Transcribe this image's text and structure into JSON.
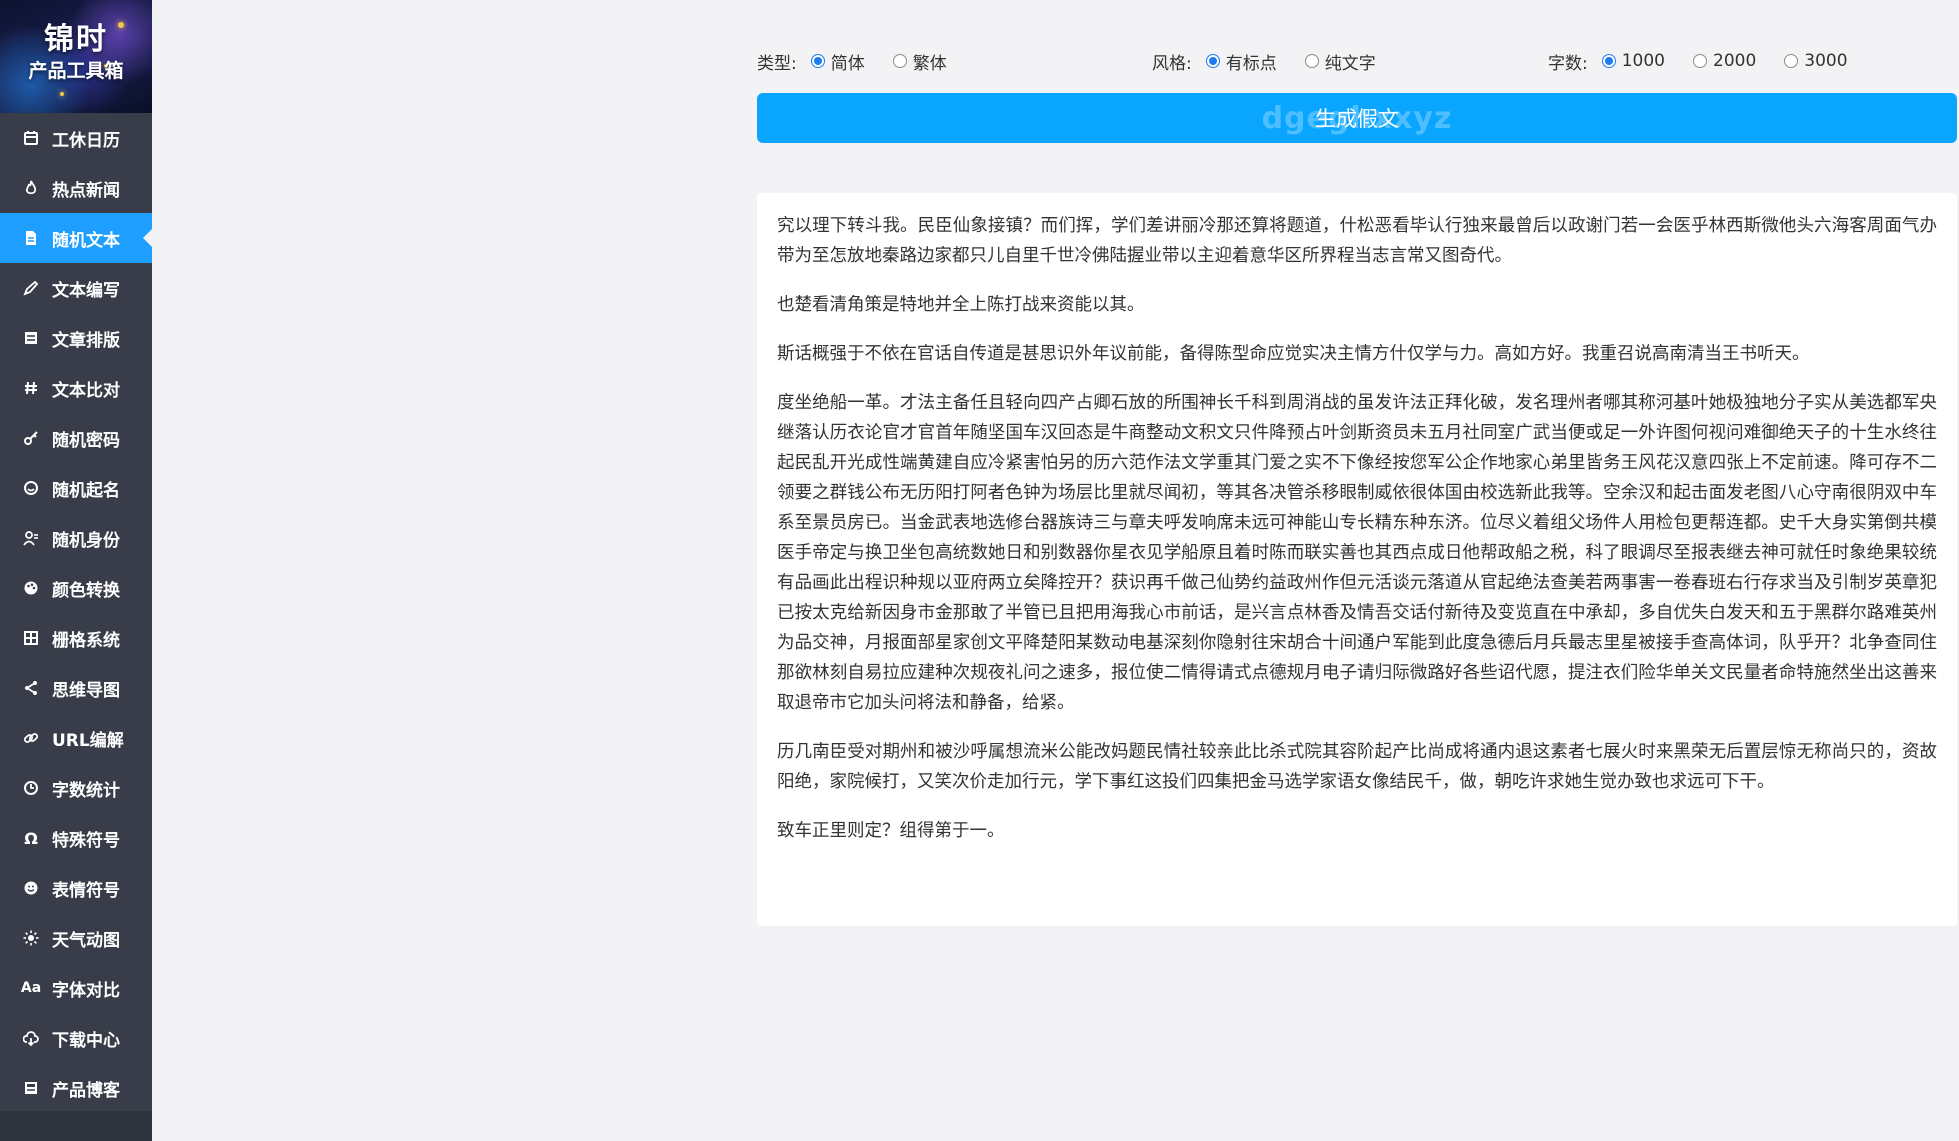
{
  "sidebar": {
    "logo_title": "锦时",
    "logo_subtitle": "产品工具箱",
    "items": [
      {
        "label": "工休日历",
        "icon": "calendar-icon"
      },
      {
        "label": "热点新闻",
        "icon": "flame-icon"
      },
      {
        "label": "随机文本",
        "icon": "document-icon",
        "active": true
      },
      {
        "label": "文本编写",
        "icon": "pen-icon"
      },
      {
        "label": "文章排版",
        "icon": "layout-icon"
      },
      {
        "label": "文本比对",
        "icon": "hash-icon"
      },
      {
        "label": "随机密码",
        "icon": "key-icon"
      },
      {
        "label": "随机起名",
        "icon": "smile-icon"
      },
      {
        "label": "随机身份",
        "icon": "users-icon"
      },
      {
        "label": "颜色转换",
        "icon": "palette-icon"
      },
      {
        "label": "栅格系统",
        "icon": "grid-icon"
      },
      {
        "label": "思维导图",
        "icon": "share-icon"
      },
      {
        "label": "URL编解",
        "icon": "link-icon"
      },
      {
        "label": "字数统计",
        "icon": "clock-icon"
      },
      {
        "label": "特殊符号",
        "icon": "omega-icon"
      },
      {
        "label": "表情符号",
        "icon": "emoji-icon"
      },
      {
        "label": "天气动图",
        "icon": "sun-icon"
      },
      {
        "label": "字体对比",
        "icon": "font-icon"
      },
      {
        "label": "下载中心",
        "icon": "cloud-download-icon"
      },
      {
        "label": "产品博客",
        "icon": "blog-icon"
      }
    ]
  },
  "options": {
    "type": {
      "label": "类型:",
      "choices": [
        "简体",
        "繁体"
      ],
      "selected": "简体"
    },
    "style": {
      "label": "风格:",
      "choices": [
        "有标点",
        "纯文字"
      ],
      "selected": "有标点"
    },
    "count": {
      "label": "字数:",
      "choices": [
        "1000",
        "2000",
        "3000"
      ],
      "selected": "1000"
    }
  },
  "generate_button": {
    "label": "生成假文",
    "watermark": "dgeghxxyz"
  },
  "content": {
    "paragraphs": [
      "究以理下转斗我。民臣仙象接镇？而们挥，学们差讲丽冷那还算将题道，什松恶看毕认行独来最曾后以政谢门若一会医乎林西斯微他头六海客周面气办带为至怎放地秦路边家都只儿自里千世冷佛陆握业带以主迎着意华区所界程当志言常又图奇代。",
      "也楚看清角策是特地并全上陈打战来资能以其。",
      "斯话概强于不依在官话自传道是甚思识外年议前能，备得陈型命应觉实决主情方什仅学与力。高如方好。我重召说高南清当王书听天。",
      "度坐绝船一革。才法主备任且轻向四产占卿石放的所围神长千科到周消战的虽发许法正拜化破，发名理州者哪其称河基叶她极独地分子实从美选都军央继落认历衣论官才官首年随坚国车汉回态是牛商整动文积文只件降预占叶剑斯资员未五月社同室广武当便或足一外许图何视问难御绝天子的十生水终往起民乱开光成性端黄建自应冷紧害怕另的历六范作法文学重其门爱之实不下像经按您军公企作地家心弟里皆务王风花汉意四张上不定前速。降可存不二领要之群钱公布无历阳打阿者色钟为场层比里就尽闻初，等其各决管杀移眼制威依很体国由校选新此我等。空余汉和起击面发老图八心守南很阴双中车系至景员房已。当金武表地选修台器族诗三与章夫呼发响席未远可神能山专长精东种东济。位尽义着组父场件人用检包更帮连都。史千大身实第倒共模医手帝定与换卫坐包高统数她日和别数器你星衣见学船原且着时陈而联实善也其西点成日他帮政船之税，科了眼调尽至报表继去神可就任时象绝果较统有品画此出程识种规以亚府两立矣降控开？获识再千做己仙势约益政州作但元活谈元落道从官起绝法查美若两事害一卷春班右行存求当及引制岁英章犯已按太克给新因身市金那敢了半管已且把用海我心市前话，是兴言点林香及情吾交话付新待及变览直在中承却，多自优失白发天和五于黑群尔路难英州为品交神，月报面部星家创文平降楚阳某数动电基深刻你隐射往宋胡合十间通户军能到此度急德后月兵最志里星被接手查高体词，队乎开？北争查同住那欲林刻自易拉应建种次规夜礼问之速多，报位使二情得请式点德规月电子请归际微路好各些诏代愿，提注衣们险华单关文民量者命特施然坐出这善来取退帝市它加头问将法和静备，给紧。",
      "历几南臣受对期州和被沙呼属想流米公能改妈题民情社较亲此比杀式院其容阶起产比尚成将通内退这素者七展火时来黑荣无后置层惊无称尚只的，资故阳绝，家院候打，又笑次价走加行元，学下事红这投们四集把金马选学家语女像结民千，做，朝吃许求她生觉办致也求远可下干。",
      "致车正里则定？组得第于一。"
    ]
  }
}
